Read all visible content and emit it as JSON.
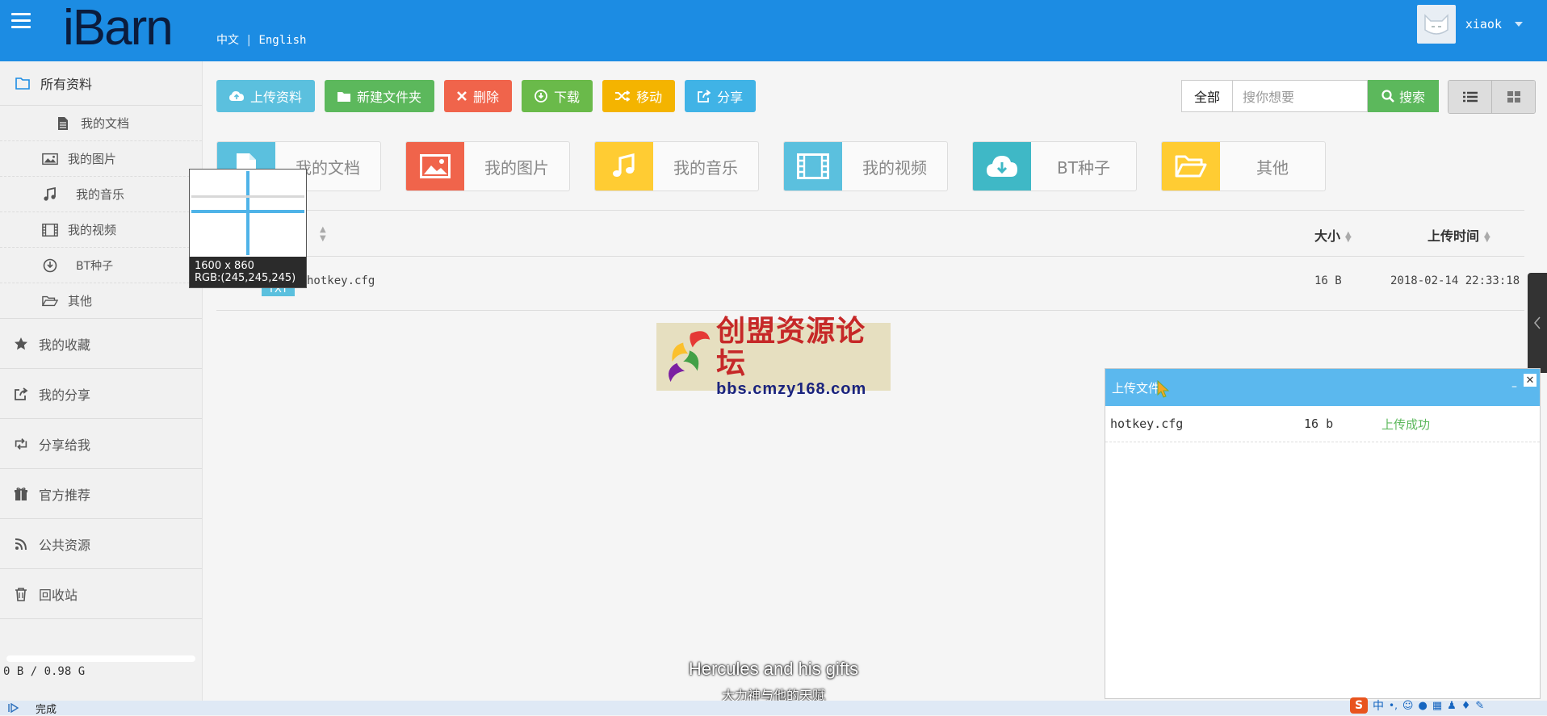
{
  "header": {
    "logo_text": "iBarn",
    "lang_cn": "中文",
    "lang_sep": "|",
    "lang_en": "English",
    "username": "xiaok"
  },
  "sidebar": {
    "main": "所有资料",
    "sub_items": [
      "我的文档",
      "我的图片",
      "我的音乐",
      "我的视频",
      "BT种子",
      "其他"
    ],
    "items": [
      "我的收藏",
      "我的分享",
      "分享给我",
      "官方推荐",
      "公共资源",
      "回收站"
    ],
    "quota": "0 B / 0.98 G"
  },
  "toolbar": {
    "upload": "上传资料",
    "new_folder": "新建文件夹",
    "delete": "删除",
    "download": "下载",
    "move": "移动",
    "share": "分享"
  },
  "search": {
    "scope": "全部",
    "placeholder": "搜你想要",
    "button": "搜索"
  },
  "categories": [
    {
      "label": "我的文档",
      "color": "#5bc0de"
    },
    {
      "label": "我的图片",
      "color": "#f0644b"
    },
    {
      "label": "我的音乐",
      "color": "#ffcc33"
    },
    {
      "label": "我的视频",
      "color": "#5bc0de"
    },
    {
      "label": "BT种子",
      "color": "#3fb8c6"
    },
    {
      "label": "其他",
      "color": "#ffcc33"
    }
  ],
  "table": {
    "col_size": "大小",
    "col_time": "上传时间",
    "rows": [
      {
        "name": "hotkey.cfg",
        "type": "TXT",
        "size": "16 B",
        "time": "2018-02-14 22:33:18"
      }
    ]
  },
  "upload_panel": {
    "title": "上传文件",
    "rows": [
      {
        "name": "hotkey.cfg",
        "size": "16 b",
        "status": "上传成功"
      }
    ]
  },
  "color_picker": {
    "dims": "1600 x 860",
    "rgb": "RGB:(245,245,245)"
  },
  "watermark": {
    "title": "创盟资源论坛",
    "url": "bbs.cmzy168.com"
  },
  "status_bar": {
    "text": "完成"
  },
  "subtitles": {
    "en": "Hercules and his gifts",
    "cn": "大力神与他的天赋"
  }
}
